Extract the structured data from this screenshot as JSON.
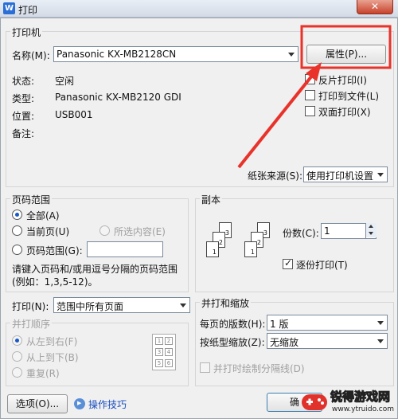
{
  "window": {
    "title": "打印",
    "app_icon_letter": "W",
    "close_label": "✕"
  },
  "printer": {
    "group_title": "打印机",
    "name_label": "名称(M):",
    "name_value": "Panasonic KX-MB2128CN",
    "properties_button": "属性(P)...",
    "status_label": "状态:",
    "status_value": "空闲",
    "type_label": "类型:",
    "type_value": "Panasonic KX-MB2120 GDI",
    "location_label": "位置:",
    "location_value": "USB001",
    "comment_label": "备注:",
    "options": {
      "reverse_print": "反片打印(I)",
      "print_to_file": "打印到文件(L)",
      "duplex": "双面打印(X)"
    },
    "paper_source_label": "纸张来源(S):",
    "paper_source_value": "使用打印机设置"
  },
  "page_range": {
    "group_title": "页码范围",
    "all": "全部(A)",
    "current": "当前页(U)",
    "selection": "所选内容(E)",
    "pages": "页码范围(G):",
    "pages_value": "",
    "hint_line1": "请键入页码和/或用逗号分隔的页码范围",
    "hint_line2": "(例如：1,3,5-12)。"
  },
  "copies": {
    "group_title": "副本",
    "count_label": "份数(C):",
    "count_value": "1",
    "collate_label": "逐份打印(T)",
    "page_numbers": [
      "1",
      "2",
      "3"
    ]
  },
  "print_what": {
    "label": "打印(N):",
    "value": "范围中所有页面"
  },
  "order": {
    "group_title": "并打顺序",
    "left_to_right": "从左到右(F)",
    "top_to_bottom": "从上到下(B)",
    "repeat": "重复(R)",
    "grid_numbers": [
      "1",
      "2",
      "3",
      "4",
      "5",
      "6"
    ]
  },
  "zoom": {
    "group_title": "并打和缩放",
    "pages_per_sheet_label": "每页的版数(H):",
    "pages_per_sheet_value": "1 版",
    "scale_label": "按纸型缩放(Z):",
    "scale_value": "无缩放",
    "draw_borders": "并打时绘制分隔线(D)"
  },
  "footer": {
    "options_button": "选项(O)...",
    "tips_link": "操作技巧",
    "ok_button": "确"
  },
  "watermark": {
    "brand": "锐得游戏网",
    "url": "www.ytruido.com"
  },
  "colors": {
    "annotation": "#e8322a",
    "accent": "#1a58c6"
  }
}
